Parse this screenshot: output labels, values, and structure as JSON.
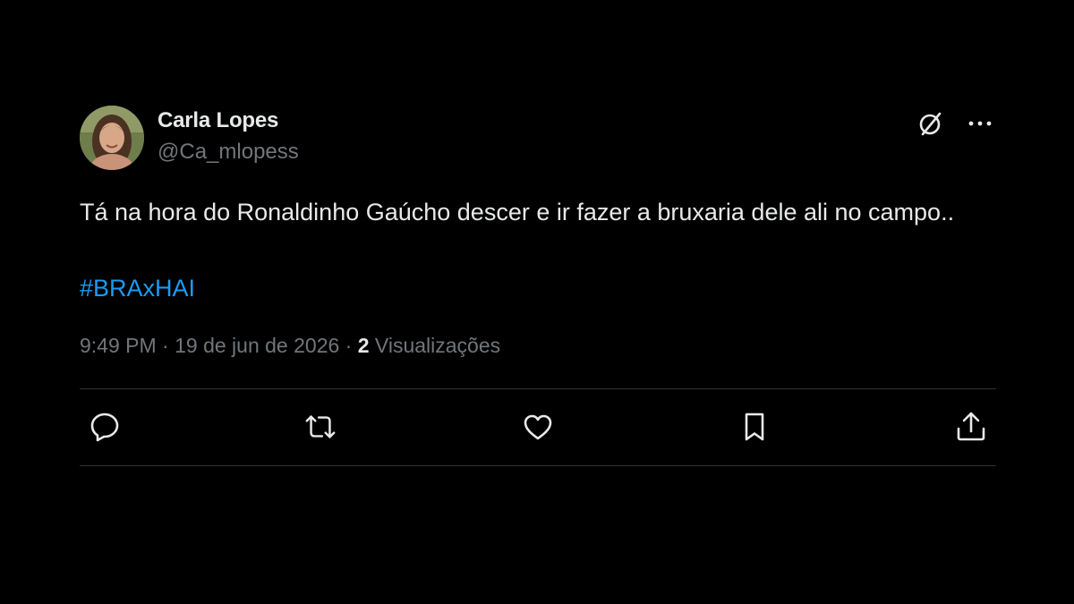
{
  "author": {
    "display_name": "Carla Lopes",
    "handle": "@Ca_mlopess",
    "avatar_icon": "profile-photo"
  },
  "tweet": {
    "text": "Tá na hora do Ronaldinho Gaúcho descer e ir fazer a bruxaria dele ali no campo..",
    "hashtag": "#BRAxHAI",
    "time": "9:49 PM",
    "separator": " · ",
    "date": "19 de jun de 2026",
    "views_count": "2",
    "views_label": " Visualizações"
  },
  "header_actions": {
    "grok_icon": "slashed-circle-icon",
    "more_icon": "more-dots-icon",
    "more_label": "···"
  },
  "actions": [
    {
      "name": "reply",
      "icon": "reply-icon"
    },
    {
      "name": "retweet",
      "icon": "retweet-icon"
    },
    {
      "name": "like",
      "icon": "like-icon"
    },
    {
      "name": "bookmark",
      "icon": "bookmark-icon"
    },
    {
      "name": "share",
      "icon": "share-icon"
    }
  ],
  "colors": {
    "background": "#000000",
    "text_primary": "#e7e9ea",
    "text_secondary": "#71767b",
    "link": "#1d9bf0",
    "divider": "#2f3336"
  }
}
